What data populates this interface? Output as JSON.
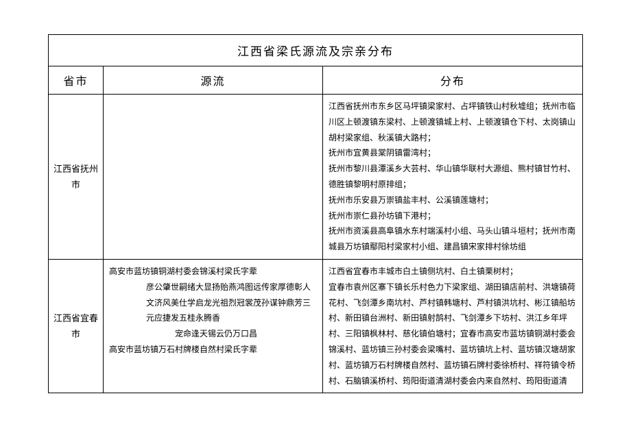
{
  "title": "江西省梁氏源流及宗亲分布",
  "headers": {
    "province": "省市",
    "source": "源流",
    "distribution": "分布"
  },
  "rows": [
    {
      "province": "江西省抚州市",
      "source": "",
      "distribution": "江西省抚州市东乡区马坪镇梁家村、占坪镇铁山村秋墟组；抚州市临川区上顿渡镇东梁村、上顿渡镇城上村、上顿渡镇仓下村、太岗镇山胡村梁家组、秋溪镇大路村；\n抚州市宜黄县棠阴镇雷湾村；\n抚州市黎川县潭溪乡大芸村、华山镇华联村大源组、熊村镇甘竹村、德胜镇黎明村原排组；\n抚州市乐安县万崇镇盐丰村、公溪镇莲塘村；\n抚州市崇仁县孙坊镇下港村；\n抚州市资溪县高阜镇水东村端溪村小组、马头山镇斗垣村；抚州市南城县万坊镇鄢阳村梁家村小组、建昌镇宋家排村徐坊组"
    },
    {
      "province": "江西省宜春市",
      "source_lines": [
        "高安市蓝坊镇铜湖村委会锦溪村梁氏字辈",
        "彦公肇世嗣绪大显扬贻燕鸿图远传家厚德彰人文济风美仕学启龙光祖烈冠裳茂孙谋钟鼎芳三元应捷发五桂永腾香",
        "宠命逢天锡云仍万口昌",
        "高安市蓝坊镇万石村牌楼自然村梁氏字辈"
      ],
      "distribution": "江西省宜春市丰城市白土镇侧坑村、白土镇栗树村；\n宜春市袁州区寨下镇长乐村色力下梁家组、湖田镇店前村、洪塘镇荷花村、飞剑潭乡南坑村、芦村镇韩塘村、芦村镇洪坑村、彬江镇船坊村、新田镇台洲村、新田镇射鹄村、飞剑潭乡下坊村、洪江乡年坪村、三阳镇枫林村、慈化镇伯塘村；宜春市高安市蓝坊镇铜湖村委会锦溪村、蓝坊镇三孙村委会梁嘴村、蓝坊镇坑上村、蓝坊镇汉塘胡家村、蓝坊镇万石村牌楼自然村、蓝坊镇石牌村委徐桥村、祥符镇令桥村、石脑镇溪桥村、筠阳街道清湖村委会内来自然村、筠阳街道清"
    }
  ]
}
